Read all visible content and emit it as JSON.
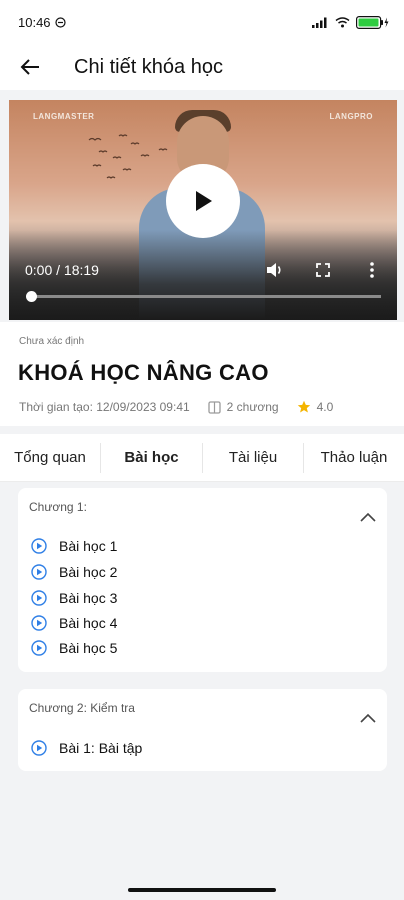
{
  "status_bar": {
    "time": "10:46",
    "battery_label": "battery-charging"
  },
  "header": {
    "title": "Chi tiết khóa học"
  },
  "video": {
    "brand_left": "LANGMASTER",
    "brand_right": "LANGPRO",
    "time_display": "0:00 / 18:19",
    "progress_fraction": 0.0
  },
  "course": {
    "category": "Chưa xác định",
    "title": "KHOÁ HỌC NÂNG CAO",
    "created": "Thời gian tạo: 12/09/2023 09:41",
    "chapters_count": "2 chương",
    "rating": "4.0"
  },
  "tabs": [
    {
      "label": "Tổng quan",
      "active": false
    },
    {
      "label": "Bài học",
      "active": true
    },
    {
      "label": "Tài liệu",
      "active": false
    },
    {
      "label": "Thảo luận",
      "active": false
    }
  ],
  "chapters": [
    {
      "title": "Chương 1:",
      "lessons": [
        "Bài học 1",
        "Bài học 2",
        "Bài học 3",
        "Bài học 4",
        "Bài học 5"
      ]
    },
    {
      "title": "Chương 2: Kiểm tra",
      "lessons": [
        "Bài 1: Bài tập"
      ]
    }
  ],
  "colors": {
    "accent": "#2f7fe6",
    "star": "#f4b400",
    "background": "#f2f3f5"
  }
}
